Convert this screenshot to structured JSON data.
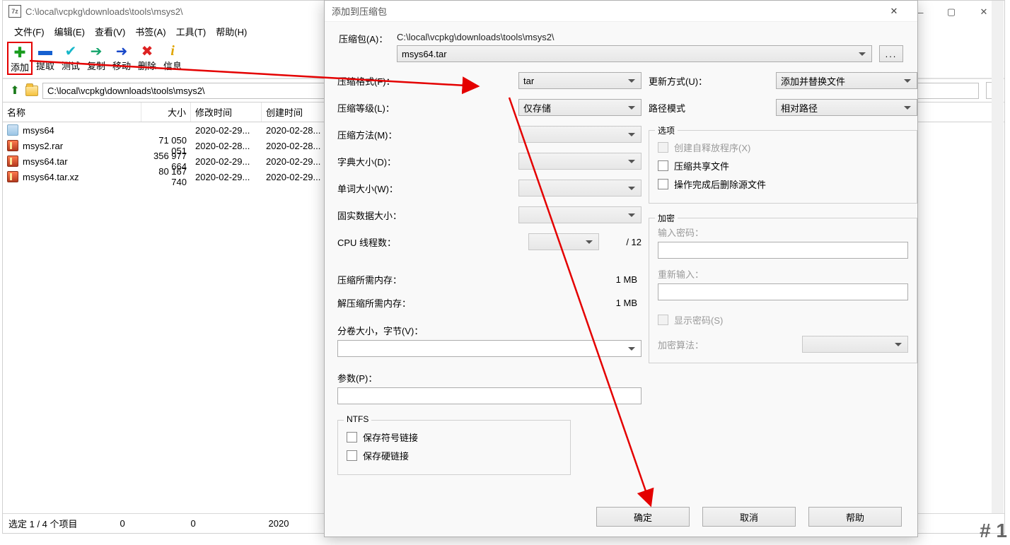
{
  "bgwin": {
    "title": "C:\\local\\vcpkg\\downloads\\tools\\msys2\\",
    "menus": {
      "file": "文件(F)",
      "edit": "编辑(E)",
      "view": "查看(V)",
      "bookmarks": "书签(A)",
      "tools": "工具(T)",
      "help": "帮助(H)"
    },
    "toolbar": {
      "add": "添加",
      "extract": "提取",
      "test": "测试",
      "copy": "复制",
      "move": "移动",
      "delete": "删除",
      "info": "信息"
    },
    "path": "C:\\local\\vcpkg\\downloads\\tools\\msys2\\",
    "columns": {
      "name": "名称",
      "size": "大小",
      "modified": "修改时间",
      "created": "创建时间"
    },
    "rows": [
      {
        "icon": "folder",
        "name": "msys64",
        "size": "",
        "modified": "2020-02-29...",
        "created": "2020-02-28..."
      },
      {
        "icon": "archive",
        "name": "msys2.rar",
        "size": "71 050 051",
        "modified": "2020-02-28...",
        "created": "2020-02-28..."
      },
      {
        "icon": "archive",
        "name": "msys64.tar",
        "size": "356 977 664",
        "modified": "2020-02-29...",
        "created": "2020-02-29..."
      },
      {
        "icon": "archive",
        "name": "msys64.tar.xz",
        "size": "80 167 740",
        "modified": "2020-02-29...",
        "created": "2020-02-29..."
      }
    ],
    "status": {
      "selected": "选定 1 / 4 个项目",
      "c0": "0",
      "c1": "0",
      "ts": "2020"
    }
  },
  "dlg": {
    "title": "添加到压缩包",
    "archive_label": "压缩包(A)：",
    "archive_path": "C:\\local\\vcpkg\\downloads\\tools\\msys2\\",
    "archive_name": "msys64.tar",
    "browse": "...",
    "format_label": "压缩格式(F)：",
    "format_value": "tar",
    "level_label": "压缩等级(L)：",
    "level_value": "仅存储",
    "method_label": "压缩方法(M)：",
    "method_value": "",
    "dict_label": "字典大小(D)：",
    "dict_value": "",
    "word_label": "单词大小(W)：",
    "word_value": "",
    "solid_label": "固实数据大小：",
    "solid_value": "",
    "threads_label": "CPU 线程数：",
    "threads_value": "",
    "threads_total": "/ 12",
    "mem_comp_label": "压缩所需内存：",
    "mem_comp_value": "1 MB",
    "mem_decomp_label": "解压缩所需内存：",
    "mem_decomp_value": "1 MB",
    "split_label": "分卷大小，字节(V)：",
    "params_label": "参数(P)：",
    "ntfs_legend": "NTFS",
    "ntfs_symlink": "保存符号链接",
    "ntfs_hardlink": "保存硬链接",
    "update_label": "更新方式(U)：",
    "update_value": "添加并替换文件",
    "pathmode_label": "路径模式",
    "pathmode_value": "相对路径",
    "options_legend": "选项",
    "opt_sfx": "创建自释放程序(X)",
    "opt_shared": "压缩共享文件",
    "opt_deletesrc": "操作完成后删除源文件",
    "enc_legend": "加密",
    "enc_pass_label": "输入密码：",
    "enc_pass2_label": "重新输入：",
    "enc_show": "显示密码(S)",
    "enc_method_label": "加密算法：",
    "btn_ok": "确定",
    "btn_cancel": "取消",
    "btn_help": "帮助"
  },
  "hash": "# 1"
}
